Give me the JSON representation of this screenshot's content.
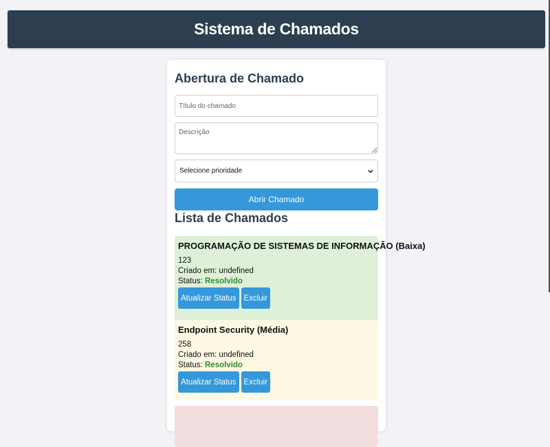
{
  "header": {
    "title": "Sistema de Chamados"
  },
  "form": {
    "title": "Abertura de Chamado",
    "title_placeholder": "Título do chamado",
    "description_placeholder": "Descrição",
    "priority_selected": "Selecione prioridade",
    "submit_label": "Abrir Chamado"
  },
  "list": {
    "title": "Lista de Chamados",
    "tickets": [
      {
        "title": "PROGRAMAÇÃO DE SISTEMAS DE INFORMAÇÃO (Baixa)",
        "description": "123",
        "created": "Criado em: undefined",
        "status_label": "Status: ",
        "status_value": "Resolvido",
        "update_label": "Atualizar Status",
        "delete_label": "Excluir",
        "color": "#dff0d8"
      },
      {
        "title": "Endpoint Security (Média)",
        "description": "258",
        "created": "Criado em: undefined",
        "status_label": "Status: ",
        "status_value": "Resolvido",
        "update_label": "Atualizar Status",
        "delete_label": "Excluir",
        "color": "#fcf8e3"
      },
      {
        "color": "#f2dede"
      }
    ]
  },
  "colors": {
    "header_bg": "#2c3e50",
    "accent": "#3498db",
    "status_resolved": "#2e8b2e"
  },
  "icons": {
    "select_arrow": "chevron-down-icon"
  }
}
